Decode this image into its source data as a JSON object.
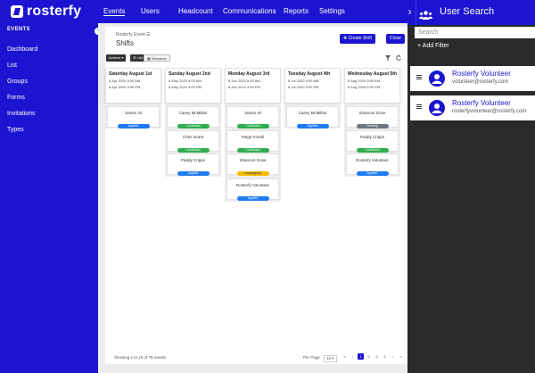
{
  "app": {
    "name": "rosterfy"
  },
  "nav": [
    "Events",
    "Users",
    "Headcount",
    "Communications",
    "Reports",
    "Settings"
  ],
  "sidebar": {
    "heading": "EVENTS",
    "items": [
      "Dashboard",
      "List",
      "Groups",
      "Forms",
      "Invitations",
      "Types"
    ],
    "toggle": "‹"
  },
  "breadcrumb": "Rosterfy Event ☰",
  "page_title": "Shifts",
  "buttons": {
    "create_shift": "✚ Create Shift",
    "close": "Close"
  },
  "toolbar": {
    "actions": "Actions ▾",
    "list": "☰ List",
    "schedule": "▦ Schedule",
    "filter_icon": "filter-icon",
    "refresh_icon": "refresh-icon"
  },
  "days": [
    {
      "title": "Saturday August 1st",
      "start": "8 Apr 2020 8:00 AM -",
      "end": "8 Apr 2020 4:00 PM"
    },
    {
      "title": "Sunday August 2nd",
      "start": "8 May 2020 8:00 AM -",
      "end": "8 May 2020 4:00 PM"
    },
    {
      "title": "Monday August 3rd",
      "start": "8 Jun 2020 8:00 AM -",
      "end": "8 Jun 2020 4:00 PM"
    },
    {
      "title": "Tuesday August 4th",
      "start": "8 Jul 2020 9:00 AM -",
      "end": "8 Jul 2020 5:00 PM"
    },
    {
      "title": "Wednesday August 5th",
      "start": "8 Aug 2020 9:00 AM -",
      "end": "8 Aug 2020 5:00 PM"
    }
  ],
  "columns": [
    [
      {
        "name": "James Ali",
        "status": "Applied"
      }
    ],
    [
      {
        "name": "Casey McMillan",
        "status": "Confirmed"
      },
      {
        "name": "Chris Grant",
        "status": "Confirmed"
      },
      {
        "name": "Paddy Cripps",
        "status": "Applied"
      }
    ],
    [
      {
        "name": "James Ali",
        "status": "Confirmed"
      },
      {
        "name": "Paige Farrell",
        "status": "Confirmed"
      },
      {
        "name": "Shannon Gove",
        "status": "Unassigned"
      },
      {
        "name": "Rosterfy Volunteer",
        "status": "Applied"
      }
    ],
    [
      {
        "name": "Casey McMillan",
        "status": "Applied"
      }
    ],
    [
      {
        "name": "Shannon Gove",
        "status": "Pending"
      },
      {
        "name": "Paddy Cripps",
        "status": "Confirmed"
      },
      {
        "name": "Rosterfy Volunteer",
        "status": "Applied"
      }
    ]
  ],
  "status_colors": {
    "Applied": "#1f7bf2",
    "Confirmed": "#2fae4f",
    "Unassigned": "#f5b800",
    "Pending": "#6c757d"
  },
  "footer": {
    "showing": "Showing 1 to 10 of 75 results",
    "per_page_label": "Per Page",
    "per_page_value": "10 ▾",
    "pages": [
      "«",
      "‹",
      "1",
      "2",
      "3",
      "4",
      "›",
      "»"
    ],
    "current_page": "1"
  },
  "user_search": {
    "title": "User Search",
    "chevron": "›",
    "placeholder": "Search",
    "add_filter": "+ Add Filter",
    "results": [
      {
        "name": "Rosterfy Volunteer",
        "email": "volunteer@rosterfy.com"
      },
      {
        "name": "Rosterfy Volunteer",
        "email": "rosterfyvolunteer@rosterfy.com"
      }
    ]
  },
  "colors": {
    "brand": "#1c14d0",
    "panel_dark": "#282a2b"
  }
}
